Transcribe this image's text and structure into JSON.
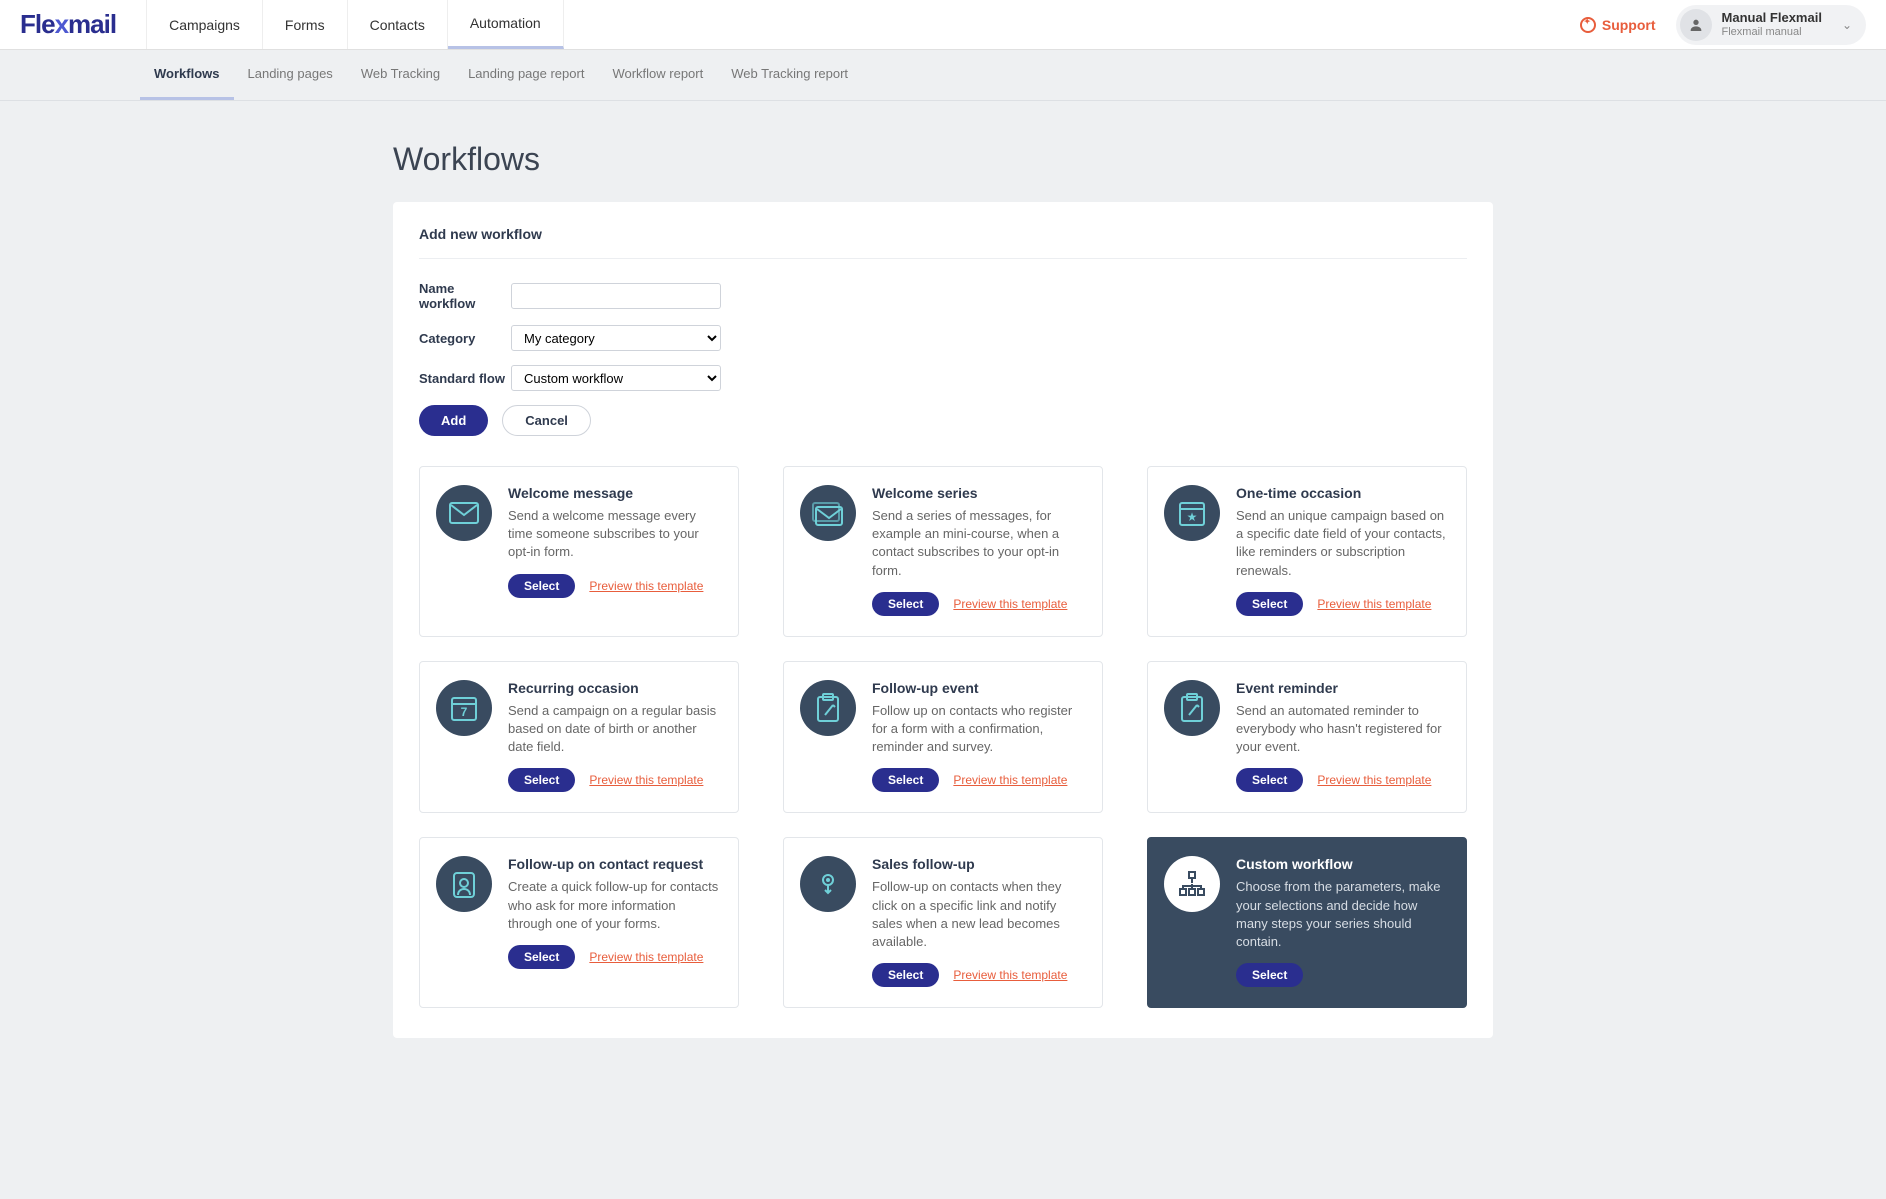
{
  "brand": "Flexmail",
  "topnav": {
    "items": [
      "Campaigns",
      "Forms",
      "Contacts",
      "Automation"
    ],
    "active_index": 3,
    "support": "Support",
    "user": {
      "name": "Manual Flexmail",
      "sub": "Flexmail manual"
    }
  },
  "subnav": {
    "items": [
      "Workflows",
      "Landing pages",
      "Web Tracking",
      "Landing page report",
      "Workflow report",
      "Web Tracking report"
    ],
    "active_index": 0
  },
  "page_title": "Workflows",
  "panel": {
    "heading": "Add new workflow",
    "labels": {
      "name": "Name workflow",
      "category": "Category",
      "standard_flow": "Standard flow"
    },
    "values": {
      "name": "",
      "category": "My category",
      "standard_flow": "Custom workflow"
    },
    "buttons": {
      "add": "Add",
      "cancel": "Cancel"
    }
  },
  "card_common": {
    "select": "Select",
    "preview": "Preview this template"
  },
  "cards": [
    {
      "title": "Welcome message",
      "desc": "Send a welcome message every time someone subscribes to your opt-in form.",
      "icon": "envelope-icon",
      "has_preview": true
    },
    {
      "title": "Welcome series",
      "desc": "Send a series of messages, for example an mini-course, when a contact subscribes to your opt-in form.",
      "icon": "envelopes-icon",
      "has_preview": true
    },
    {
      "title": "One-time occasion",
      "desc": "Send an unique campaign based on a specific date field of your contacts, like reminders or subscription renewals.",
      "icon": "calendar-star-icon",
      "has_preview": true
    },
    {
      "title": "Recurring occasion",
      "desc": "Send a campaign on a regular basis based on date of birth or another date field.",
      "icon": "calendar-7-icon",
      "has_preview": true
    },
    {
      "title": "Follow-up event",
      "desc": "Follow up on contacts who register for a form with a confirmation, reminder and survey.",
      "icon": "clipboard-icon",
      "has_preview": true
    },
    {
      "title": "Event reminder",
      "desc": "Send an automated reminder to everybody who hasn't registered for your event.",
      "icon": "clipboard-icon",
      "has_preview": true
    },
    {
      "title": "Follow-up on contact request",
      "desc": "Create a quick follow-up for contacts who ask for more information through one of your forms.",
      "icon": "person-badge-icon",
      "has_preview": true
    },
    {
      "title": "Sales follow-up",
      "desc": "Follow-up on contacts when they click on a specific link and notify sales when a new lead becomes available.",
      "icon": "pointer-icon",
      "has_preview": true
    },
    {
      "title": "Custom workflow",
      "desc": "Choose from the parameters, make your selections and decide how many steps your series should contain.",
      "icon": "tree-icon",
      "has_preview": false,
      "dark": true
    }
  ]
}
